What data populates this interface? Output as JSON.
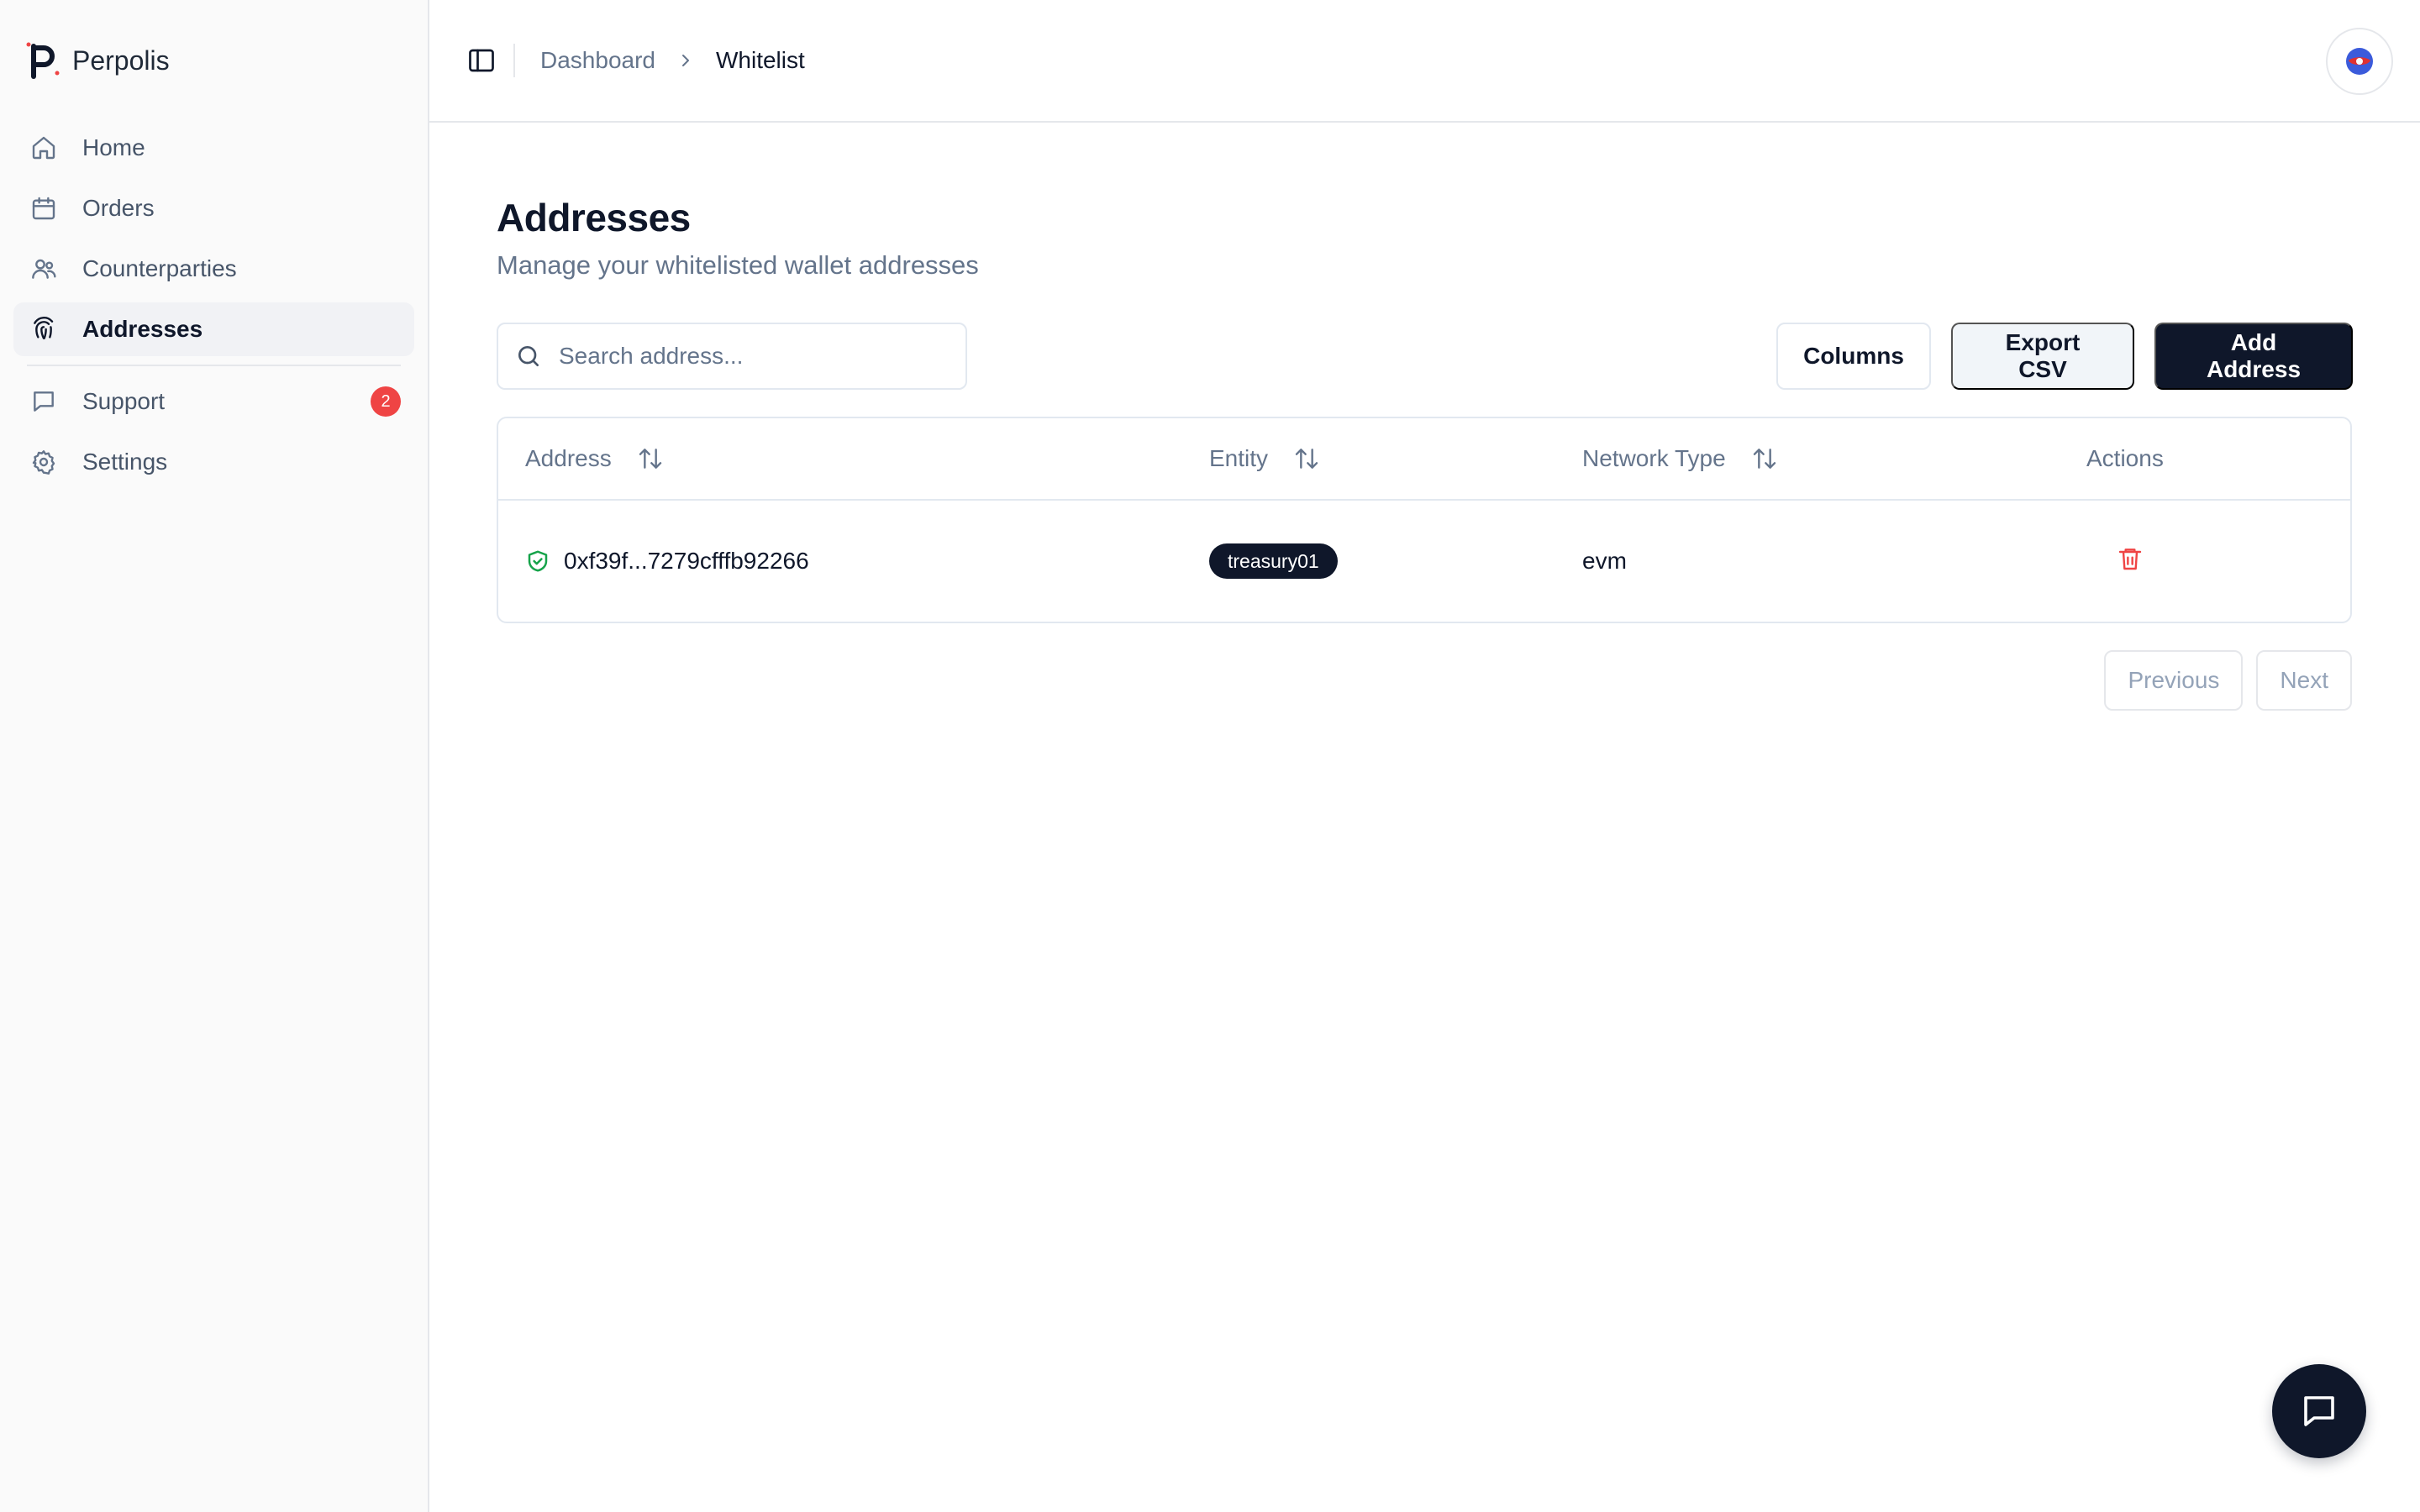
{
  "brand": {
    "name": "Perpolis",
    "logo_icon": "perpolis-logo"
  },
  "sidebar": {
    "items": [
      {
        "label": "Home",
        "icon": "home-icon"
      },
      {
        "label": "Orders",
        "icon": "calendar-icon"
      },
      {
        "label": "Counterparties",
        "icon": "users-icon"
      },
      {
        "label": "Addresses",
        "icon": "fingerprint-icon",
        "active": true
      },
      {
        "label": "Support",
        "icon": "message-square-icon",
        "badge": "2"
      },
      {
        "label": "Settings",
        "icon": "gear-icon"
      }
    ]
  },
  "breadcrumb": {
    "parent": "Dashboard",
    "current": "Whitelist"
  },
  "page": {
    "title": "Addresses",
    "subtitle": "Manage your whitelisted wallet addresses"
  },
  "toolbar": {
    "search_placeholder": "Search address...",
    "columns_label": "Columns",
    "export_label": "Export CSV",
    "add_label": "Add Address"
  },
  "table": {
    "columns": [
      "Address",
      "Entity",
      "Network Type",
      "Actions"
    ],
    "rows": [
      {
        "address": "0xf39f...7279cfffb92266",
        "entity": "treasury01",
        "network": "evm"
      }
    ]
  },
  "pagination": {
    "previous": "Previous",
    "next": "Next"
  },
  "colors": {
    "primary": "#0f172a",
    "accent_red": "#ef4444",
    "verified_green": "#16a34a",
    "muted_text": "#64748b"
  }
}
